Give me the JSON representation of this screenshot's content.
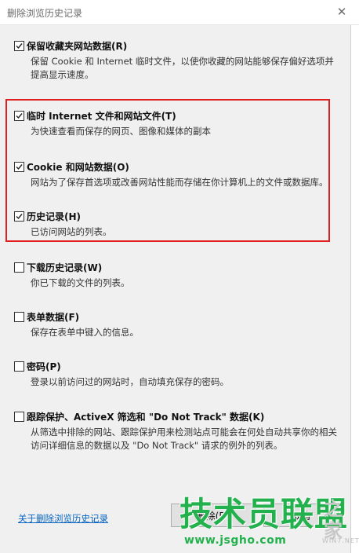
{
  "window": {
    "title": "删除浏览历史记录",
    "close_glyph": "✕"
  },
  "options": [
    {
      "label": "保留收藏夹网站数据(R)",
      "description": "保留 Cookie 和 Internet 临时文件，以使你收藏的网站能够保存偏好选项并提高显示速度。",
      "checked": true
    },
    {
      "label": "临时 Internet 文件和网站文件(T)",
      "description": "为快速查看而保存的网页、图像和媒体的副本",
      "checked": true
    },
    {
      "label": "Cookie 和网站数据(O)",
      "description": "网站为了保存首选项或改善网站性能而存储在你计算机上的文件或数据库。",
      "checked": true
    },
    {
      "label": "历史记录(H)",
      "description": "已访问网站的列表。",
      "checked": true
    },
    {
      "label": "下载历史记录(W)",
      "description": "你已下载的文件的列表。",
      "checked": false
    },
    {
      "label": "表单数据(F)",
      "description": "保存在表单中键入的信息。",
      "checked": false
    },
    {
      "label": "密码(P)",
      "description": "登录以前访问过的网站时，自动填充保存的密码。",
      "checked": false
    },
    {
      "label": "跟踪保护、ActiveX 筛选和 \"Do Not Track\" 数据(K)",
      "description": "从筛选中排除的网站、跟踪保护用来检测站点可能会在何处自动共享你的相关访问详细信息的数据以及 \"Do Not Track\" 请求的例外的列表。",
      "checked": false
    }
  ],
  "footer": {
    "about_link": "关于删除浏览历史记录",
    "delete_button": "删除(D)",
    "cancel_button": "取消"
  },
  "watermark": {
    "main": "技术员联盟",
    "side": "之家",
    "url": "www.jsgho.com",
    "sub": "WIN7.NET"
  },
  "colors": {
    "highlight_border": "#e02020",
    "link": "#0563c1",
    "watermark": "#22b14c"
  },
  "icons": {
    "checkbox_checked": "checkmark-icon",
    "close": "close-icon"
  }
}
